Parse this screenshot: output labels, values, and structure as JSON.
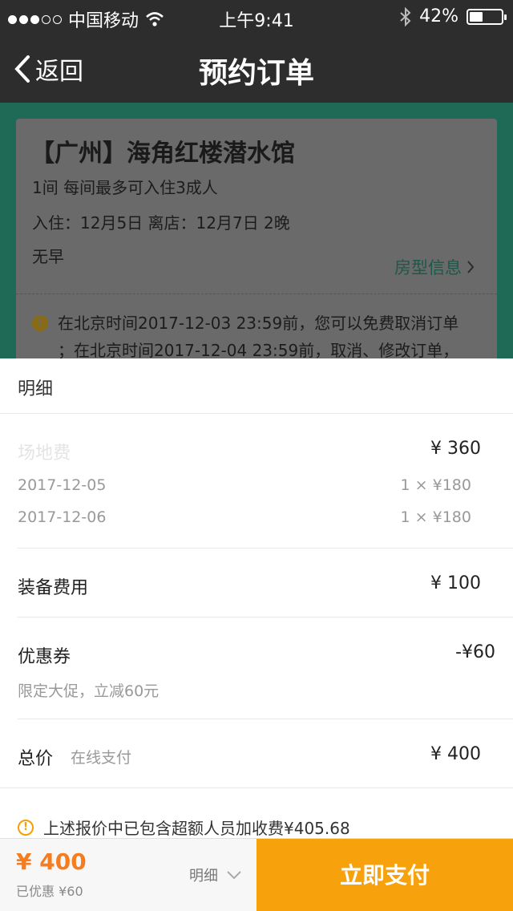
{
  "status_bar": {
    "carrier": "中国移动",
    "time": "上午9:41",
    "battery_percent": "42%",
    "battery_level": 0.42,
    "signal_bars_filled": 3,
    "signal_bars_total": 5
  },
  "nav": {
    "back_label": "返回",
    "title": "预约订单"
  },
  "booking": {
    "hotel_name": "【广州】海角红楼潜水馆",
    "room_desc": "1间 每间最多可入住3成人",
    "dates": "入住：12月5日 离店：12月7日 2晚",
    "breakfast": "无早",
    "room_info_link": "房型信息",
    "cancel_notice_line1": "在北京时间2017-12-03 23:59前，您可以免费取消订单",
    "cancel_notice_line2": "；在北京时间2017-12-04 23:59前，取消、修改订单，"
  },
  "detail": {
    "title": "明细",
    "venue_fee_label": "场地费",
    "venue_fee_value": "¥ 360",
    "nights": [
      {
        "date": "2017-12-05",
        "amount": "1 ×  ¥180"
      },
      {
        "date": "2017-12-06",
        "amount": "1 ×  ¥180"
      }
    ],
    "equipment_label": "装备费用",
    "equipment_value": "¥ 100",
    "coupon_label": "优惠券",
    "coupon_value": "-¥60",
    "coupon_note": "限定大促，立减60元",
    "total_label": "总价",
    "total_sub": "在线支付",
    "total_value": "¥ 400",
    "footnote": "上述报价中已包含超额人员加收费¥405.68"
  },
  "bottom_bar": {
    "price": "¥ 400",
    "saved": "已优惠 ¥60",
    "detail_toggle": "明细",
    "pay_button": "立即支付"
  },
  "colors": {
    "accent_orange": "#f7a20c",
    "price_orange": "#f57c1f",
    "nav_bg": "#2d2d2d",
    "teal_bg": "#1f6a57"
  }
}
